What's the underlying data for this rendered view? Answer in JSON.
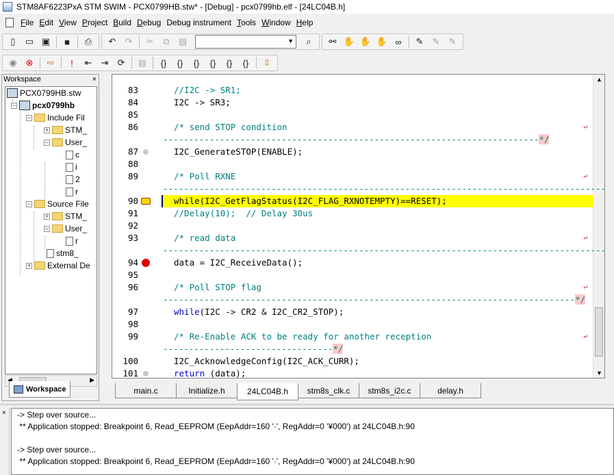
{
  "window": {
    "title": "STM8AF6223PxA STM SWIM - PCX0799HB.stw* - [Debug] - pcx0799hb.elf - [24LC04B.h]"
  },
  "menu": [
    {
      "label": "File",
      "key": "F",
      "rest": "ile"
    },
    {
      "label": "Edit",
      "key": "E",
      "rest": "dit"
    },
    {
      "label": "View",
      "key": "V",
      "rest": "iew"
    },
    {
      "label": "Project",
      "key": "P",
      "rest": "roject"
    },
    {
      "label": "Build",
      "key": "B",
      "rest": "uild"
    },
    {
      "label": "Debug",
      "key": "D",
      "rest": "ebug"
    },
    {
      "label": "Debug instrument",
      "key": "Debug ",
      "rest": "instrument"
    },
    {
      "label": "Tools",
      "key": "T",
      "rest": "ools"
    },
    {
      "label": "Window",
      "key": "W",
      "rest": "indow"
    },
    {
      "label": "Help",
      "key": "H",
      "rest": "elp"
    }
  ],
  "workspace": {
    "title": "Workspace",
    "tab_label": "Workspace",
    "tree": [
      {
        "label": "PCX0799HB.stw",
        "kind": "proj",
        "bold": false
      },
      {
        "label": "pcx0799hb",
        "kind": "proj",
        "bold": true
      },
      {
        "label": "Include Fil",
        "kind": "folder",
        "bold": false
      },
      {
        "label": "STM_",
        "kind": "folder",
        "bold": false
      },
      {
        "label": "User_",
        "kind": "folder",
        "bold": false
      },
      {
        "label": "c",
        "kind": "file",
        "bold": false
      },
      {
        "label": "i",
        "kind": "file",
        "bold": false
      },
      {
        "label": "2",
        "kind": "file",
        "bold": false
      },
      {
        "label": "r",
        "kind": "file",
        "bold": false
      },
      {
        "label": "Source File",
        "kind": "folder",
        "bold": false
      },
      {
        "label": "STM_",
        "kind": "folder",
        "bold": false
      },
      {
        "label": "User_",
        "kind": "folder",
        "bold": false
      },
      {
        "label": "r",
        "kind": "file",
        "bold": false
      },
      {
        "label": "stm8_",
        "kind": "file",
        "bold": false
      },
      {
        "label": "External De",
        "kind": "folder",
        "bold": false
      }
    ]
  },
  "editor": {
    "lines": [
      {
        "n": "83",
        "text": "//I2C -> SR1;",
        "cls": "cmt"
      },
      {
        "n": "84",
        "text": "I2C -> SR3;",
        "cls": ""
      },
      {
        "n": "85",
        "text": "",
        "cls": ""
      },
      {
        "n": "86",
        "text": "/* send STOP condition",
        "cls": "cmt"
      },
      {
        "n": "",
        "text": "-------------------------------------------------------------------------",
        "cls": "dash",
        "end": "*/"
      },
      {
        "n": "87",
        "text": "I2C_GenerateSTOP(ENABLE);",
        "cls": ""
      },
      {
        "n": "88",
        "text": "",
        "cls": ""
      },
      {
        "n": "89",
        "text": "/* Poll RXNE",
        "cls": "cmt"
      },
      {
        "n": "",
        "text": "------------------------------------------------------------------------------------------",
        "cls": "dash",
        "end": "*/"
      },
      {
        "n": "90",
        "text": "while(I2C_GetFlagStatus(I2C_FLAG_RXNOTEMPTY)==RESET);",
        "cls": ""
      },
      {
        "n": "91",
        "text": "//Delay(10);  // Delay 30us",
        "cls": "cmt"
      },
      {
        "n": "92",
        "text": "",
        "cls": ""
      },
      {
        "n": "93",
        "text": "/* read data",
        "cls": "cmt"
      },
      {
        "n": "",
        "text": "------------------------------------------------------------------------------------------",
        "cls": "dash",
        "end": "*/"
      },
      {
        "n": "94",
        "text": "data = I2C_ReceiveData();",
        "cls": ""
      },
      {
        "n": "95",
        "text": "",
        "cls": ""
      },
      {
        "n": "96",
        "text": "/* Poll STOP flag",
        "cls": "cmt"
      },
      {
        "n": "",
        "text": "--------------------------------------------------------------------------------",
        "cls": "dash",
        "end": "*/"
      },
      {
        "n": "97",
        "text": "while(I2C -> CR2 & I2C_CR2_STOP);",
        "cls": "while"
      },
      {
        "n": "98",
        "text": "",
        "cls": ""
      },
      {
        "n": "99",
        "text": "/* Re-Enable ACK to be ready for another reception",
        "cls": "cmt"
      },
      {
        "n": "",
        "text": "---------------------------------",
        "cls": "dash",
        "end": "*/"
      },
      {
        "n": "100",
        "text": "I2C_AcknowledgeConfig(I2C_ACK_CURR);",
        "cls": ""
      },
      {
        "n": "101",
        "text": "return (data);",
        "cls": "return"
      }
    ],
    "while_kw": "while",
    "while_rest": "(I2C -> CR2 & I2C_CR2_STOP);",
    "return_kw": "return",
    "return_rest": " (data);"
  },
  "tabs": [
    "main.c",
    "Initialize.h",
    "24LC04B.h",
    "stm8s_clk.c",
    "stm8s_i2c.c",
    "delay.h"
  ],
  "active_tab": "24LC04B.h",
  "output": [
    "-> Step over source...",
    " ** Application stopped: Breakpoint 6, Read_EEPROM (EepAddr=160 '·', RegAddr=0 '¥000') at 24LC04B.h:90",
    "",
    "-> Step over source...",
    " ** Application stopped: Breakpoint 6, Read_EEPROM (EepAddr=160 '·', RegAddr=0 '¥000') at 24LC04B.h:90"
  ]
}
